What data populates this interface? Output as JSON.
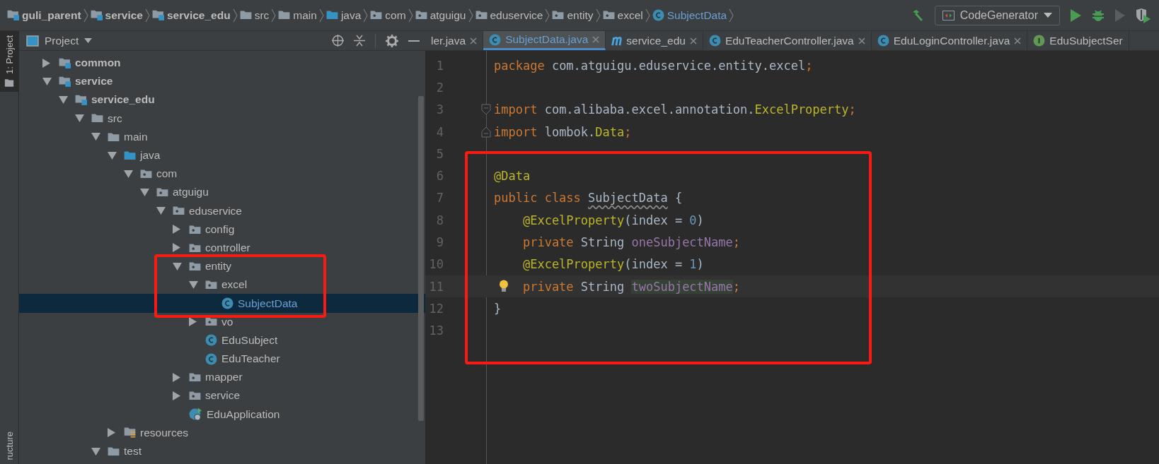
{
  "breadcrumbs": [
    {
      "label": "guli_parent",
      "kind": "module"
    },
    {
      "label": "service",
      "kind": "module"
    },
    {
      "label": "service_edu",
      "kind": "module"
    },
    {
      "label": "src",
      "kind": "folder"
    },
    {
      "label": "main",
      "kind": "folder"
    },
    {
      "label": "java",
      "kind": "source"
    },
    {
      "label": "com",
      "kind": "package"
    },
    {
      "label": "atguigu",
      "kind": "package"
    },
    {
      "label": "eduservice",
      "kind": "package"
    },
    {
      "label": "entity",
      "kind": "package"
    },
    {
      "label": "excel",
      "kind": "package"
    },
    {
      "label": "SubjectData",
      "kind": "class"
    }
  ],
  "run_config": {
    "label": "CodeGenerator"
  },
  "tool_windows": [
    {
      "label": "1: Project",
      "selected": true
    },
    {
      "label": "ructure",
      "selected": false
    }
  ],
  "project_panel": {
    "title": "Project",
    "annotated": true,
    "tree": [
      {
        "label": "common",
        "kind": "module",
        "expanded": false,
        "selected": false
      },
      {
        "label": "service",
        "kind": "module",
        "expanded": true,
        "selected": false,
        "children": [
          {
            "label": "service_edu",
            "kind": "module",
            "expanded": true,
            "selected": false,
            "children": [
              {
                "label": "src",
                "kind": "folder",
                "expanded": true,
                "selected": false,
                "children": [
                  {
                    "label": "main",
                    "kind": "folder",
                    "expanded": true,
                    "selected": false,
                    "children": [
                      {
                        "label": "java",
                        "kind": "source",
                        "expanded": true,
                        "selected": false,
                        "children": [
                          {
                            "label": "com",
                            "kind": "package",
                            "expanded": true,
                            "selected": false,
                            "children": [
                              {
                                "label": "atguigu",
                                "kind": "package",
                                "expanded": true,
                                "selected": false,
                                "children": [
                                  {
                                    "label": "eduservice",
                                    "kind": "package",
                                    "expanded": true,
                                    "selected": false,
                                    "children": [
                                      {
                                        "label": "config",
                                        "kind": "package",
                                        "expanded": false,
                                        "selected": false
                                      },
                                      {
                                        "label": "controller",
                                        "kind": "package",
                                        "expanded": false,
                                        "selected": false
                                      },
                                      {
                                        "label": "entity",
                                        "kind": "package",
                                        "expanded": true,
                                        "selected": false,
                                        "children": [
                                          {
                                            "label": "excel",
                                            "kind": "package",
                                            "expanded": true,
                                            "selected": false,
                                            "children": [
                                              {
                                                "label": "SubjectData",
                                                "kind": "class",
                                                "selected": true
                                              }
                                            ]
                                          },
                                          {
                                            "label": "vo",
                                            "kind": "package",
                                            "expanded": false,
                                            "selected": false
                                          },
                                          {
                                            "label": "EduSubject",
                                            "kind": "class",
                                            "selected": false
                                          },
                                          {
                                            "label": "EduTeacher",
                                            "kind": "class",
                                            "selected": false
                                          }
                                        ]
                                      },
                                      {
                                        "label": "mapper",
                                        "kind": "package",
                                        "expanded": false,
                                        "selected": false
                                      },
                                      {
                                        "label": "service",
                                        "kind": "package",
                                        "expanded": false,
                                        "selected": false
                                      },
                                      {
                                        "label": "EduApplication",
                                        "kind": "app",
                                        "selected": false
                                      }
                                    ]
                                  }
                                ]
                              }
                            ]
                          }
                        ]
                      },
                      {
                        "label": "resources",
                        "kind": "resources",
                        "expanded": false,
                        "selected": false
                      }
                    ]
                  },
                  {
                    "label": "test",
                    "kind": "folder",
                    "expanded": true,
                    "selected": false
                  }
                ]
              }
            ]
          }
        ]
      }
    ]
  },
  "tabs": [
    {
      "label": "ler.java",
      "selected": false,
      "closable": true
    },
    {
      "label": "SubjectData.java",
      "kind": "class",
      "selected": true,
      "closable": true
    },
    {
      "label": "service_edu",
      "kind": "maven",
      "selected": false,
      "closable": true
    },
    {
      "label": "EduTeacherController.java",
      "kind": "class",
      "selected": false,
      "closable": true
    },
    {
      "label": "EduLoginController.java",
      "kind": "class",
      "selected": false,
      "closable": true
    },
    {
      "label": "EduSubjectSer",
      "kind": "interface",
      "selected": false,
      "closable": false
    }
  ],
  "code": [
    {
      "number": "1",
      "tokens": [
        {
          "kind": "keyword",
          "text": "package "
        },
        {
          "kind": "plain",
          "text": "com.atguigu.eduservice.entity.excel"
        },
        {
          "kind": "keyword",
          "text": ";"
        }
      ]
    },
    {
      "number": "2"
    },
    {
      "number": "3",
      "fold_start": true,
      "tokens": [
        {
          "kind": "keyword",
          "text": "import "
        },
        {
          "kind": "plain",
          "text": "com.alibaba.excel.annotation."
        },
        {
          "kind": "annotation",
          "text": "ExcelProperty"
        },
        {
          "kind": "keyword",
          "text": ";"
        }
      ]
    },
    {
      "number": "4",
      "fold_end": true,
      "tokens": [
        {
          "kind": "keyword",
          "text": "import "
        },
        {
          "kind": "plain",
          "text": "lombok."
        },
        {
          "kind": "annotation",
          "text": "Data"
        },
        {
          "kind": "keyword",
          "text": ";"
        }
      ]
    },
    {
      "number": "5"
    },
    {
      "number": "6",
      "tokens": [
        {
          "kind": "annotation",
          "text": "@Data"
        }
      ]
    },
    {
      "number": "7",
      "tokens": [
        {
          "kind": "keyword",
          "text": "public class "
        },
        {
          "kind": "warning",
          "text": "SubjectData"
        },
        {
          "kind": "plain",
          "text": " {"
        }
      ]
    },
    {
      "number": "8",
      "tokens": [
        {
          "kind": "annotation",
          "text": "    @ExcelProperty"
        },
        {
          "kind": "plain",
          "text": "(index = "
        },
        {
          "kind": "number",
          "text": "0"
        },
        {
          "kind": "plain",
          "text": ")"
        }
      ]
    },
    {
      "number": "9",
      "tokens": [
        {
          "kind": "keyword",
          "text": "    private "
        },
        {
          "kind": "plain",
          "text": "String "
        },
        {
          "kind": "field",
          "text": "oneSubjectName"
        },
        {
          "kind": "keyword",
          "text": ";"
        }
      ]
    },
    {
      "number": "10",
      "tokens": [
        {
          "kind": "annotation",
          "text": "    @ExcelProperty"
        },
        {
          "kind": "plain",
          "text": "(index = "
        },
        {
          "kind": "number",
          "text": "1"
        },
        {
          "kind": "plain",
          "text": ")"
        }
      ]
    },
    {
      "number": "11",
      "current": true,
      "bulb": true,
      "tokens": [
        {
          "kind": "keyword",
          "text": "    private "
        },
        {
          "kind": "plain",
          "text": "String "
        },
        {
          "kind": "field-highlight",
          "text": "twoSubjectName"
        },
        {
          "kind": "keyword",
          "text": ";"
        }
      ]
    },
    {
      "number": "12",
      "tokens": [
        {
          "kind": "plain",
          "text": "}"
        }
      ]
    },
    {
      "number": "13"
    }
  ],
  "code_annotated": true
}
